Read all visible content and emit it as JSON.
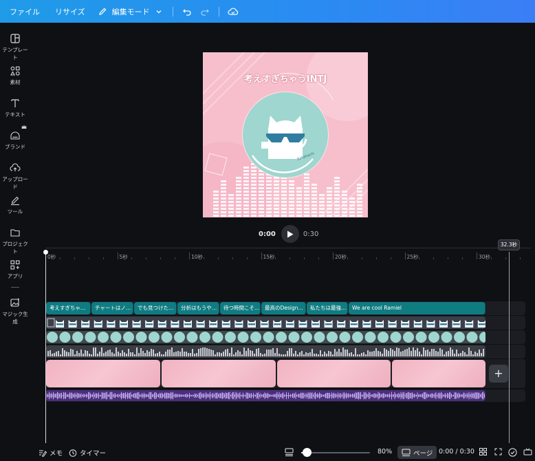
{
  "topbar": {
    "file": "ファイル",
    "resize": "リサイズ",
    "edit_mode": "編集モード"
  },
  "sidebar": {
    "items": [
      {
        "label": "テンプレート",
        "icon": "template-icon"
      },
      {
        "label": "素材",
        "icon": "elements-icon"
      },
      {
        "label": "テキスト",
        "icon": "text-icon"
      },
      {
        "label": "ブランド",
        "icon": "brand-icon"
      },
      {
        "label": "アップロード",
        "icon": "upload-icon"
      },
      {
        "label": "ツール",
        "icon": "draw-tool-icon"
      },
      {
        "label": "プロジェクト",
        "icon": "folder-icon"
      },
      {
        "label": "アプリ",
        "icon": "apps-icon"
      },
      {
        "label": "マジック生成",
        "icon": "magic-media-icon"
      }
    ]
  },
  "canvas": {
    "title": "考えすぎちゃうINTJ",
    "colors": {
      "bg": "#f7bfcc",
      "circle": "#9fd6cf",
      "accent": "#ffffff"
    }
  },
  "player": {
    "current": "0:00",
    "duration": "0:30"
  },
  "timeline": {
    "ticks": [
      "0秒",
      "5秒",
      "10秒",
      "15秒",
      "20秒",
      "25秒",
      "30秒"
    ],
    "end_badge": "32.3秒",
    "text_clips": [
      "考えすぎちゃ…",
      "チャートはノ…",
      "でも見つけた…",
      "分析はもうや…",
      "待つ時間こそ…",
      "最高のDesign…",
      "私たちは最強…",
      "We are cool Ramiel"
    ],
    "image_clip_count": 4,
    "colors": {
      "text_track": "#0f7c82",
      "audio": "#7b4fc0",
      "circles": "#9fd6cf"
    }
  },
  "bottombar": {
    "memo": "メモ",
    "timer": "タイマー",
    "zoom": "80%",
    "zoom_fraction": 0.08,
    "page": "ページ",
    "time": "0:00 / 0:30"
  }
}
